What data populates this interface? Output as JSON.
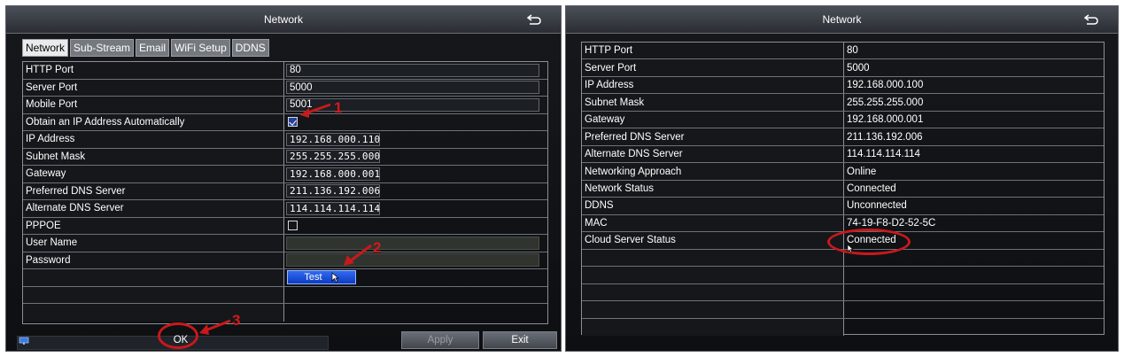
{
  "colors": {
    "accent_red": "#c8191b",
    "test_button_blue": "#1f52de",
    "panel_bg": "#0f1114"
  },
  "left_window": {
    "title": "Network",
    "tabs": [
      {
        "label": "Network",
        "active": true
      },
      {
        "label": "Sub-Stream",
        "active": false
      },
      {
        "label": "Email",
        "active": false
      },
      {
        "label": "WiFi Setup",
        "active": false
      },
      {
        "label": "DDNS",
        "active": false
      }
    ],
    "rows": {
      "http_port": {
        "label": "HTTP Port",
        "value": "80"
      },
      "server_port": {
        "label": "Server Port",
        "value": "5000"
      },
      "mobile_port": {
        "label": "Mobile Port",
        "value": "5001"
      },
      "obtain_ip": {
        "label": "Obtain an IP Address Automatically",
        "checked": true
      },
      "ip_address": {
        "label": "IP Address",
        "value": "192.168.000.110"
      },
      "subnet_mask": {
        "label": "Subnet Mask",
        "value": "255.255.255.000"
      },
      "gateway": {
        "label": "Gateway",
        "value": "192.168.000.001"
      },
      "preferred_dns": {
        "label": "Preferred DNS Server",
        "value": "211.136.192.006"
      },
      "alternate_dns": {
        "label": "Alternate DNS Server",
        "value": "114.114.114.114"
      },
      "pppoe": {
        "label": "PPPOE",
        "checked": false
      },
      "user_name": {
        "label": "User Name",
        "value": ""
      },
      "password": {
        "label": "Password",
        "value": ""
      },
      "test_label": "Test"
    },
    "buttons": {
      "ok": "OK",
      "apply": "Apply",
      "exit": "Exit"
    }
  },
  "right_window": {
    "title": "Network",
    "rows": [
      {
        "label": "HTTP Port",
        "value": "80"
      },
      {
        "label": "Server Port",
        "value": "5000"
      },
      {
        "label": "IP Address",
        "value": "192.168.000.100"
      },
      {
        "label": "Subnet Mask",
        "value": "255.255.255.000"
      },
      {
        "label": "Gateway",
        "value": "192.168.000.001"
      },
      {
        "label": "Preferred DNS Server",
        "value": "211.136.192.006"
      },
      {
        "label": "Alternate DNS Server",
        "value": "114.114.114.114"
      },
      {
        "label": "Networking Approach",
        "value": "Online"
      },
      {
        "label": "Network Status",
        "value": "Connected"
      },
      {
        "label": "DDNS",
        "value": "Unconnected"
      },
      {
        "label": "MAC",
        "value": "74-19-F8-D2-52-5C"
      },
      {
        "label": "Cloud Server Status",
        "value": "Connected"
      },
      {
        "label": "",
        "value": ""
      },
      {
        "label": "",
        "value": ""
      },
      {
        "label": "",
        "value": ""
      },
      {
        "label": "",
        "value": ""
      },
      {
        "label": "",
        "value": ""
      }
    ]
  },
  "annotations": {
    "step1": "1",
    "step2": "2",
    "step3": "3"
  }
}
